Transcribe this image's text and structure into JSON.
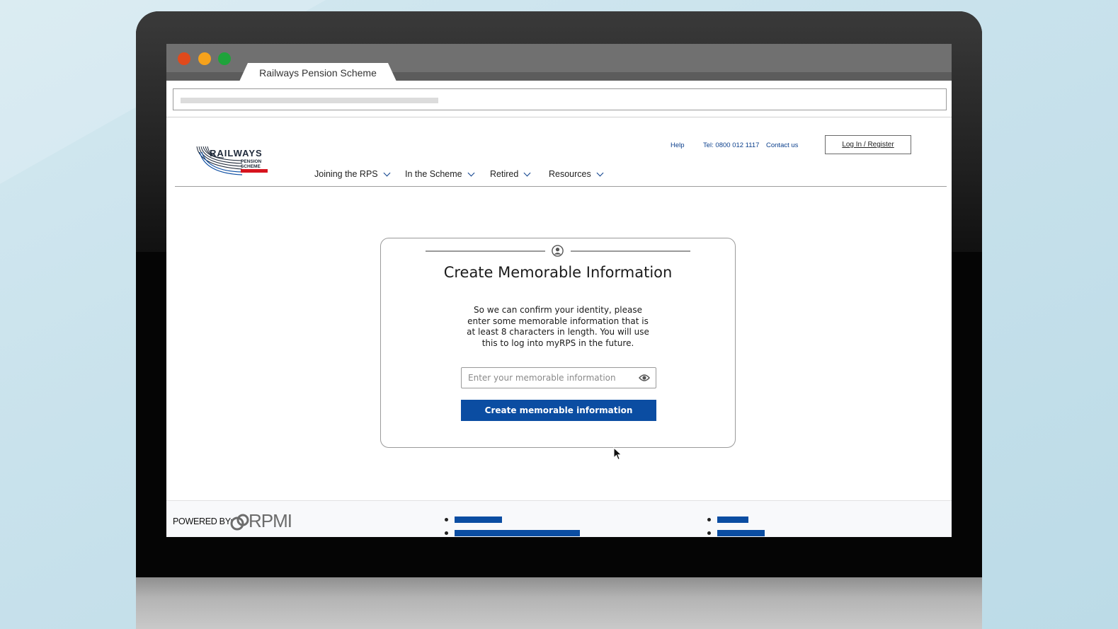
{
  "browser": {
    "tab_title": "Railways Pension Scheme"
  },
  "site": {
    "logo": {
      "wordmark": "RAILWAYS",
      "sub_line1": "PENSION",
      "sub_line2": "SCHEME"
    },
    "top_links": {
      "help": "Help",
      "tel": "Tel: 0800 012 1117",
      "contact": "Contact us"
    },
    "login_label": "Log In / Register",
    "nav": [
      {
        "label": "Joining the RPS"
      },
      {
        "label": "In the Scheme"
      },
      {
        "label": "Retired"
      },
      {
        "label": "Resources"
      }
    ]
  },
  "card": {
    "title": "Create Memorable Information",
    "description": "So we can confirm your identity, please enter some memorable information that is at least 8 characters in length. You will use this to log into myRPS in the future.",
    "input_placeholder": "Enter your memorable information",
    "input_value": "",
    "submit_label": "Create memorable information"
  },
  "footer": {
    "powered_by": "POWERED BY:",
    "brand": "RPMI"
  },
  "colors": {
    "brand_blue": "#0b4da2",
    "link_blue": "#0b3f8c",
    "logo_red": "#d7141e"
  }
}
